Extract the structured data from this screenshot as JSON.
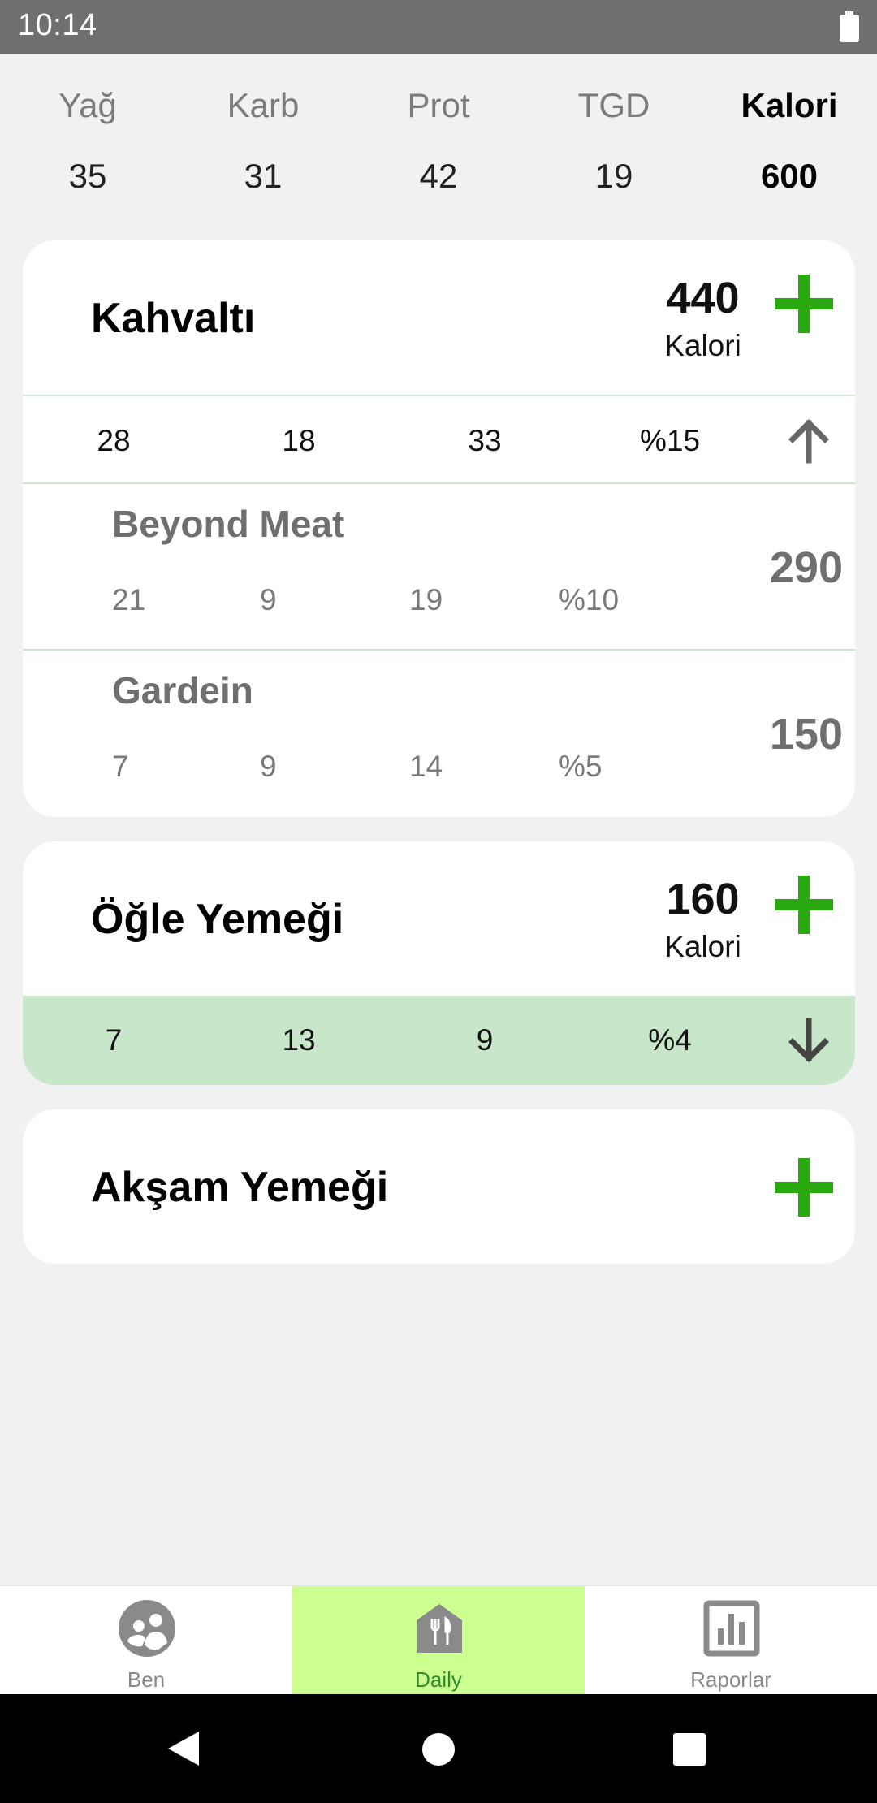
{
  "status_bar": {
    "time": "10:14"
  },
  "summary": {
    "columns": [
      {
        "label": "Yağ",
        "value": "35"
      },
      {
        "label": "Karb",
        "value": "31"
      },
      {
        "label": "Prot",
        "value": "42"
      },
      {
        "label": "TGD",
        "value": "19"
      },
      {
        "label": "Kalori",
        "value": "600"
      }
    ]
  },
  "meals": [
    {
      "title": "Kahvaltı",
      "calories": "440",
      "calories_label": "Kalori",
      "totals": [
        "28",
        "18",
        "33",
        "%15"
      ],
      "expanded": true,
      "foods": [
        {
          "name": "Beyond Meat",
          "macros": [
            "21",
            "9",
            "19",
            "%10"
          ],
          "calories": "290"
        },
        {
          "name": "Gardein",
          "macros": [
            "7",
            "9",
            "14",
            "%5"
          ],
          "calories": "150"
        }
      ]
    },
    {
      "title": "Öğle Yemeği",
      "calories": "160",
      "calories_label": "Kalori",
      "totals": [
        "7",
        "13",
        "9",
        "%4"
      ],
      "expanded": false
    },
    {
      "title": "Akşam Yemeği"
    }
  ],
  "bottom_nav": {
    "items": [
      {
        "label": "Ben",
        "icon": "people-icon"
      },
      {
        "label": "Daily",
        "icon": "meal-house-icon",
        "active": true
      },
      {
        "label": "Raporlar",
        "icon": "bar-chart-icon"
      }
    ]
  },
  "colors": {
    "accent_green": "#2aa80f",
    "light_green": "#c8e6c9",
    "nav_active_bg": "#ccff90"
  }
}
